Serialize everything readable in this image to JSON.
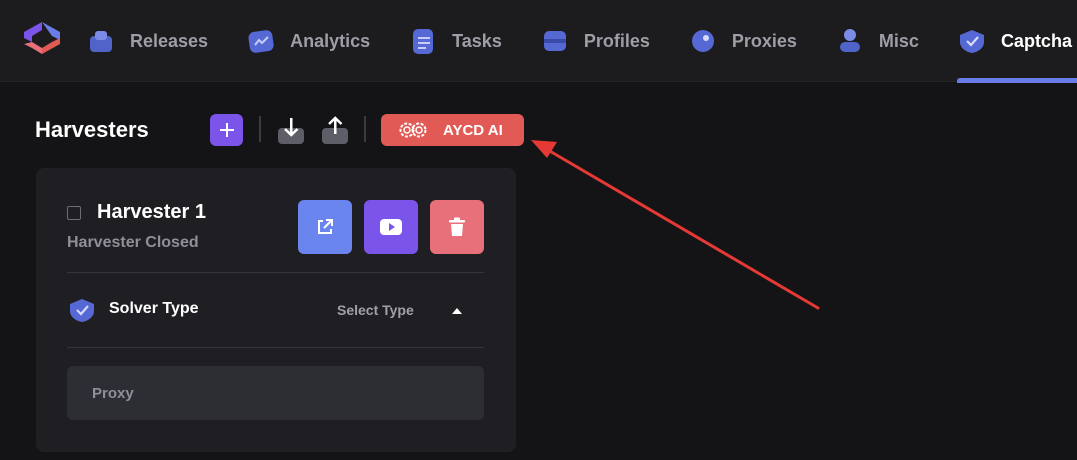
{
  "nav": {
    "tabs": [
      {
        "label": "Releases",
        "icon": "releases-icon",
        "active": false
      },
      {
        "label": "Analytics",
        "icon": "analytics-icon",
        "active": false
      },
      {
        "label": "Tasks",
        "icon": "tasks-icon",
        "active": false
      },
      {
        "label": "Profiles",
        "icon": "profiles-icon",
        "active": false
      },
      {
        "label": "Proxies",
        "icon": "proxies-icon",
        "active": false
      },
      {
        "label": "Misc",
        "icon": "misc-icon",
        "active": false
      },
      {
        "label": "Captcha",
        "icon": "captcha-icon",
        "active": true
      }
    ]
  },
  "header": {
    "title": "Harvesters",
    "aycd_label": "AYCD AI"
  },
  "harvester": {
    "name": "Harvester 1",
    "status": "Harvester Closed",
    "solver_label": "Solver Type",
    "solver_value": "Select Type",
    "proxy_placeholder": "Proxy"
  },
  "colors": {
    "accent_purple": "#7b55ea",
    "accent_blue": "#6b85ee",
    "accent_red": "#e15a55",
    "delete_pink": "#e8707a",
    "active_tab_underline": "#6a7ce8",
    "annotation_arrow": "#e53935"
  }
}
